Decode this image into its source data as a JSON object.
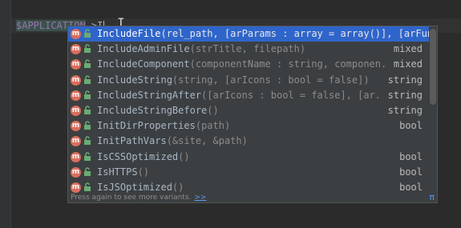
{
  "editor": {
    "var_text": "$APPLICATION",
    "arrow_text": "->",
    "typed_text": "I"
  },
  "completion": {
    "items": [
      {
        "name": "IncludeFile",
        "params": "(rel_path, [arParams : array = array()], [arFunctionPa",
        "type": ""
      },
      {
        "name": "IncludeAdminFile",
        "params": "(strTitle, filepath)",
        "type": "mixed"
      },
      {
        "name": "IncludeComponent",
        "params": "(componentName : string, componen...",
        "type": "mixed"
      },
      {
        "name": "IncludeString",
        "params": "(string, [arIcons : bool = false])",
        "type": "string"
      },
      {
        "name": "IncludeStringAfter",
        "params": "([arIcons : bool = false], [ar...",
        "type": "string"
      },
      {
        "name": "IncludeStringBefore",
        "params": "()",
        "type": "string"
      },
      {
        "name": "InitDirProperties",
        "params": "(path)",
        "type": "bool"
      },
      {
        "name": "InitPathVars",
        "params": "(&site, &path)",
        "type": ""
      },
      {
        "name": "IsCSSOptimized",
        "params": "()",
        "type": "bool"
      },
      {
        "name": "IsHTTPS",
        "params": "()",
        "type": "bool"
      },
      {
        "name": "IsJSOptimized",
        "params": "()",
        "type": "bool"
      }
    ],
    "footer_text": "Press again to see more variants.",
    "footer_link": ">>",
    "pi_symbol": "π",
    "method_badge": "m",
    "colors": {
      "selection": "#2f65ca",
      "method_icon": "#d96e5c",
      "lock_icon": "#6aab73"
    }
  }
}
